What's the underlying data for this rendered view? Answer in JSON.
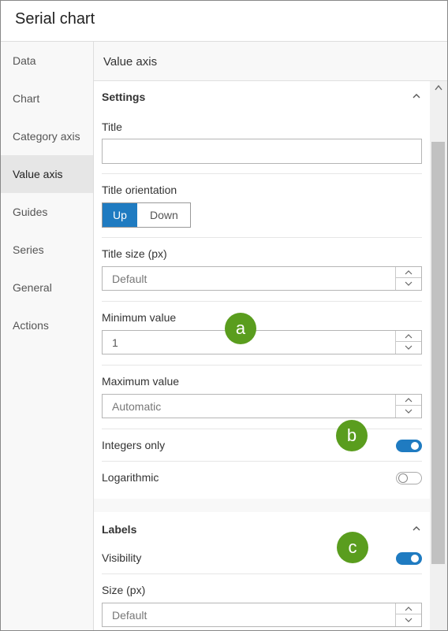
{
  "header": {
    "title": "Serial chart"
  },
  "sidebar": {
    "items": [
      {
        "label": "Data"
      },
      {
        "label": "Chart"
      },
      {
        "label": "Category axis"
      },
      {
        "label": "Value axis"
      },
      {
        "label": "Guides"
      },
      {
        "label": "Series"
      },
      {
        "label": "General"
      },
      {
        "label": "Actions"
      }
    ],
    "active_index": 3
  },
  "main": {
    "title": "Value axis",
    "settings": {
      "heading": "Settings",
      "title_label": "Title",
      "title_value": "",
      "title_orientation_label": "Title orientation",
      "orientation_options": [
        "Up",
        "Down"
      ],
      "orientation_selected": "Up",
      "title_size_label": "Title size (px)",
      "title_size_placeholder": "Default",
      "minimum_label": "Minimum value",
      "minimum_value": "1",
      "maximum_label": "Maximum value",
      "maximum_placeholder": "Automatic",
      "integers_label": "Integers only",
      "integers_on": true,
      "logarithmic_label": "Logarithmic",
      "logarithmic_on": false
    },
    "labels": {
      "heading": "Labels",
      "visibility_label": "Visibility",
      "visibility_on": true,
      "size_label": "Size (px)",
      "size_placeholder": "Default"
    }
  },
  "callouts": [
    "a",
    "b",
    "c"
  ],
  "colors": {
    "accent": "#1f7bc1",
    "callout": "#5a9d1e"
  }
}
